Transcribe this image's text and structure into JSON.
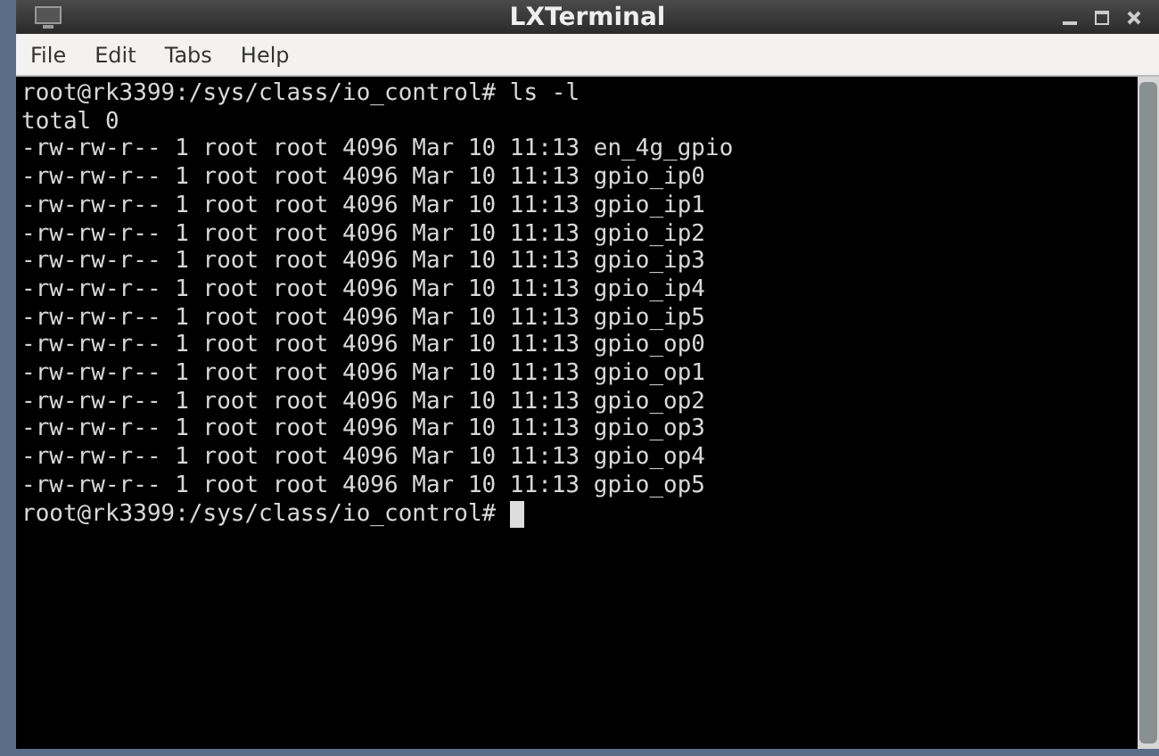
{
  "window": {
    "title": "LXTerminal"
  },
  "menu": [
    "File",
    "Edit",
    "Tabs",
    "Help"
  ],
  "terminal": {
    "lines": [
      "root@rk3399:/sys/class/io_control# ls -l",
      "total 0",
      "-rw-rw-r-- 1 root root 4096 Mar 10 11:13 en_4g_gpio",
      "-rw-rw-r-- 1 root root 4096 Mar 10 11:13 gpio_ip0",
      "-rw-rw-r-- 1 root root 4096 Mar 10 11:13 gpio_ip1",
      "-rw-rw-r-- 1 root root 4096 Mar 10 11:13 gpio_ip2",
      "-rw-rw-r-- 1 root root 4096 Mar 10 11:13 gpio_ip3",
      "-rw-rw-r-- 1 root root 4096 Mar 10 11:13 gpio_ip4",
      "-rw-rw-r-- 1 root root 4096 Mar 10 11:13 gpio_ip5",
      "-rw-rw-r-- 1 root root 4096 Mar 10 11:13 gpio_op0",
      "-rw-rw-r-- 1 root root 4096 Mar 10 11:13 gpio_op1",
      "-rw-rw-r-- 1 root root 4096 Mar 10 11:13 gpio_op2",
      "-rw-rw-r-- 1 root root 4096 Mar 10 11:13 gpio_op3",
      "-rw-rw-r-- 1 root root 4096 Mar 10 11:13 gpio_op4",
      "-rw-rw-r-- 1 root root 4096 Mar 10 11:13 gpio_op5"
    ],
    "prompt": "root@rk3399:/sys/class/io_control# "
  }
}
